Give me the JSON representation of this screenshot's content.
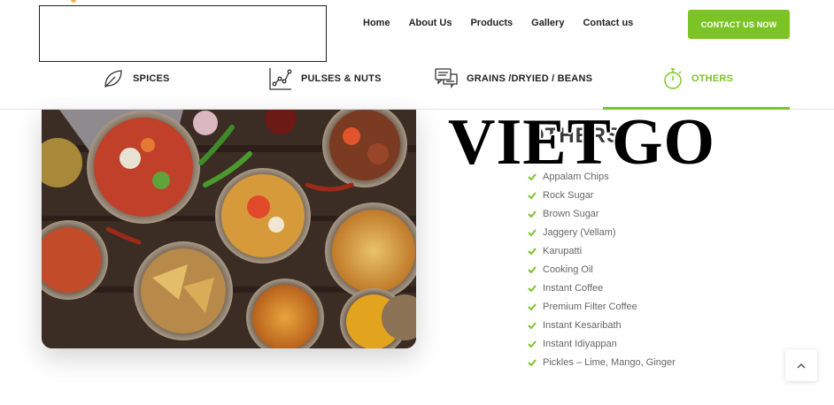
{
  "header": {
    "nav": [
      "Home",
      "About Us",
      "Products",
      "Gallery",
      "Contact us"
    ],
    "contact_button": "CONTACT US NOW"
  },
  "tabs": [
    {
      "label": "SPICES",
      "icon": "leaf-icon"
    },
    {
      "label": "PULSES & NUTS",
      "icon": "line-chart-icon"
    },
    {
      "label": "GRAINS /DRYIED / BEANS",
      "icon": "chat-bubbles-icon"
    },
    {
      "label": "OTHERS",
      "icon": "stopwatch-icon",
      "active": true
    }
  ],
  "content": {
    "heading": "OTHERS",
    "watermark": "VIETGO",
    "items": [
      "Appalam Chips",
      "Rock Sugar",
      "Brown Sugar",
      "Jaggery (Vellam)",
      "Karupatti",
      "Cooking Oil",
      "Instant Coffee",
      "Premium Filter Coffee",
      "Instant Kesaribath",
      "Instant Idiyappan",
      "Pickles – Lime, Mango, Ginger"
    ]
  },
  "colors": {
    "accent": "#7cc425",
    "text": "#222222",
    "muted": "#666666"
  },
  "icons": {
    "check": "check-icon",
    "scroll_top": "chevron-up-icon"
  }
}
